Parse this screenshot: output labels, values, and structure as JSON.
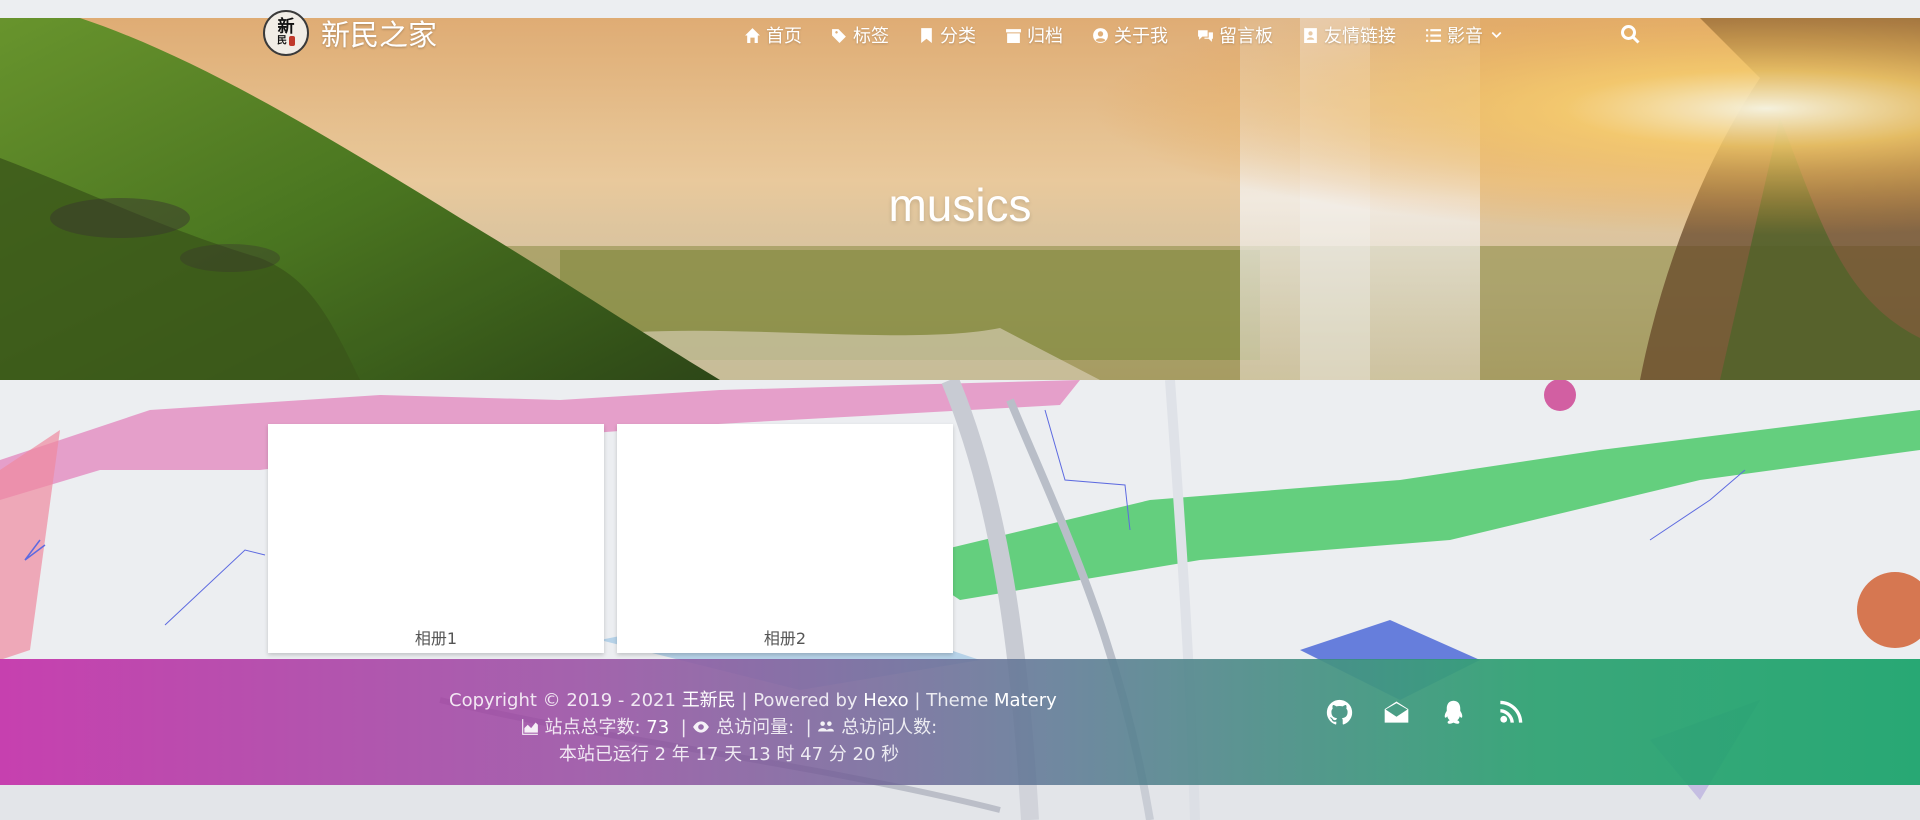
{
  "brand": {
    "logo_line1": "新",
    "logo_line2": "民",
    "name": "新民之家"
  },
  "nav": {
    "items": [
      {
        "label": "首页",
        "icon": "home-icon"
      },
      {
        "label": "标签",
        "icon": "tags-icon"
      },
      {
        "label": "分类",
        "icon": "bookmark-icon"
      },
      {
        "label": "归档",
        "icon": "archive-icon"
      },
      {
        "label": "关于我",
        "icon": "user-circle-icon"
      },
      {
        "label": "留言板",
        "icon": "comments-icon"
      },
      {
        "label": "友情链接",
        "icon": "address-book-icon"
      },
      {
        "label": "影音",
        "icon": "list-icon",
        "dropdown": true
      }
    ],
    "search_icon": "search-icon"
  },
  "banner": {
    "title": "musics"
  },
  "albums": [
    {
      "label": "相册1"
    },
    {
      "label": "相册2"
    }
  ],
  "footer": {
    "copyright_prefix": "Copyright © 2019 - 2021",
    "author": "王新民",
    "powered_by_label": "| Powered by",
    "powered_by": "Hexo",
    "theme_label": "| Theme",
    "theme": "Matery",
    "word_count_label": "站点总字数:",
    "word_count": "73",
    "visits_label": "总访问量:",
    "visitors_label": "总访问人数:",
    "runtime": "本站已运行 2 年 17 天 13 时 47 分 20 秒"
  },
  "social": [
    "github-icon",
    "envelope-icon",
    "qq-icon",
    "rss-icon"
  ]
}
